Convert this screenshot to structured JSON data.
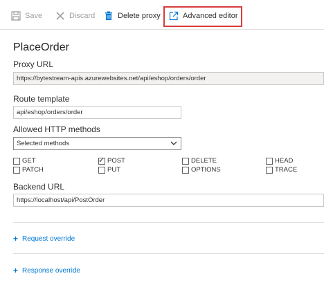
{
  "toolbar": {
    "save": "Save",
    "discard": "Discard",
    "delete_proxy": "Delete proxy",
    "advanced_editor": "Advanced editor"
  },
  "proxy": {
    "name": "PlaceOrder",
    "proxy_url_label": "Proxy URL",
    "proxy_url": "https://bytestream-apis.azurewebsites.net/api/eshop/orders/order",
    "route_template_label": "Route template",
    "route_template": "api/eshop/orders/order",
    "allowed_methods_label": "Allowed HTTP methods",
    "allowed_methods_selected": "Selected methods",
    "methods": [
      {
        "name": "GET",
        "checked": false
      },
      {
        "name": "POST",
        "checked": true
      },
      {
        "name": "DELETE",
        "checked": false
      },
      {
        "name": "HEAD",
        "checked": false
      },
      {
        "name": "PATCH",
        "checked": false
      },
      {
        "name": "PUT",
        "checked": false
      },
      {
        "name": "OPTIONS",
        "checked": false
      },
      {
        "name": "TRACE",
        "checked": false
      }
    ],
    "backend_url_label": "Backend URL",
    "backend_url": "https://localhost/api/PostOrder"
  },
  "links": {
    "request_override": "Request override",
    "response_override": "Response override"
  },
  "colors": {
    "accent": "#0078d4",
    "highlight": "#d83b3b",
    "delete_icon": "#0078d4"
  }
}
